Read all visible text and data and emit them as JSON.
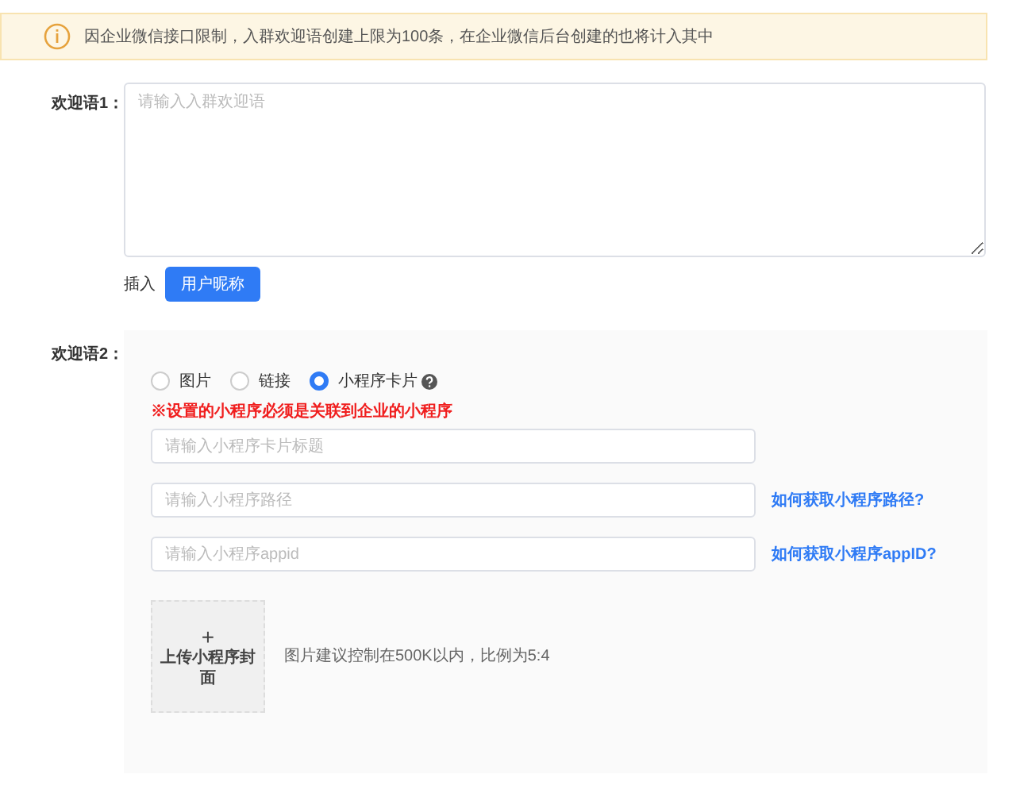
{
  "notice": {
    "text": "因企业微信接口限制，入群欢迎语创建上限为100条，在企业微信后台创建的也将计入其中"
  },
  "welcome_1": {
    "label": "欢迎语1：",
    "placeholder": "请输入入群欢迎语",
    "insert_label": "插入",
    "insert_button": "用户昵称"
  },
  "welcome_2": {
    "label": "欢迎语2：",
    "types": [
      {
        "label": "图片",
        "selected": false
      },
      {
        "label": "链接",
        "selected": false
      },
      {
        "label": "小程序卡片",
        "selected": true
      }
    ],
    "warning": "※设置的小程序必须是关联到企业的小程序",
    "fields": [
      {
        "placeholder": "请输入小程序卡片标题"
      },
      {
        "placeholder": "请输入小程序路径",
        "link": "如何获取小程序路径?"
      },
      {
        "placeholder": "请输入小程序appid",
        "link": "如何获取小程序appID?"
      }
    ],
    "upload": {
      "plus": "+",
      "label": "上传小程序封面"
    },
    "hint": "图片建议控制在500K以内，比例为5:4"
  }
}
